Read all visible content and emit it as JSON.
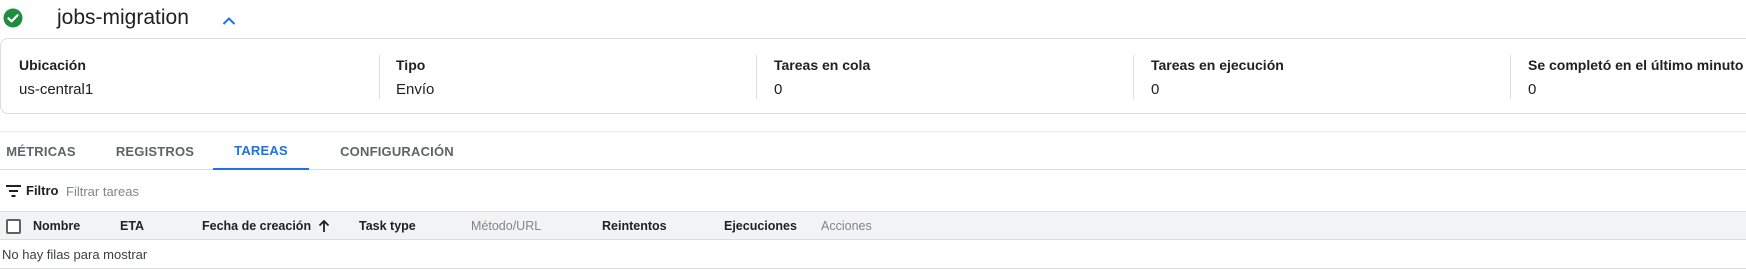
{
  "header": {
    "title": "jobs-migration",
    "status_icon": "check-circle-icon",
    "collapse_icon": "chevron-up-icon"
  },
  "info": {
    "location": {
      "label": "Ubicación",
      "value": "us-central1"
    },
    "type": {
      "label": "Tipo",
      "value": "Envío"
    },
    "queued": {
      "label": "Tareas en cola",
      "value": "0"
    },
    "running": {
      "label": "Tareas en ejecución",
      "value": "0"
    },
    "completed": {
      "label": "Se completó en el último minuto",
      "value": "0",
      "help_icon": "help-icon"
    }
  },
  "tabs": [
    {
      "label": "MÉTRICAS",
      "active": false
    },
    {
      "label": "REGISTROS",
      "active": false
    },
    {
      "label": "TAREAS",
      "active": true
    },
    {
      "label": "CONFIGURACIÓN",
      "active": false
    }
  ],
  "filter": {
    "label": "Filtro",
    "placeholder": "Filtrar tareas",
    "icon": "filter-icon"
  },
  "table": {
    "columns": [
      "Nombre",
      "ETA",
      "Fecha de creación",
      "Task type",
      "Método/URL",
      "Reintentos",
      "Ejecuciones",
      "Acciones"
    ],
    "sort_icon": "arrow-upward-icon",
    "empty_message": "No hay filas para mostrar"
  },
  "colors": {
    "accent": "#1a73e8",
    "success": "#1e8e3e",
    "text": "#202124",
    "muted": "#80868b",
    "header_bg": "#f1f3f4",
    "border": "#dadce0"
  }
}
